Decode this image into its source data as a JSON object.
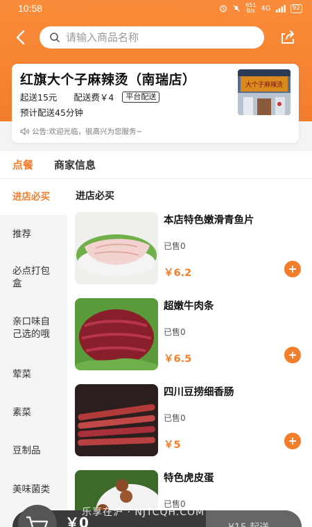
{
  "status_bar": {
    "time": "10:58",
    "net_speed_top": "651",
    "net_speed_bottom": "B/s",
    "signal": "4G",
    "battery": "92"
  },
  "nav": {
    "search_placeholder": "请输入商品名称"
  },
  "shop": {
    "name": "红旗大个子麻辣烫（南瑞店）",
    "min_order": "起送15元",
    "delivery_fee": "配送费￥4",
    "delivery_tag": "平台配送",
    "eta": "预计配送45分钟",
    "notice": "公告:欢迎光临，很高兴为您服务~",
    "sign_text": "大个子麻辣烫"
  },
  "tabs": [
    {
      "label": "点餐"
    },
    {
      "label": "商家信息"
    }
  ],
  "sidebar": {
    "items": [
      {
        "label": "进店必买"
      },
      {
        "label": "推荐"
      },
      {
        "label": "必点打包盒"
      },
      {
        "label": "亲口味自己选的哦"
      },
      {
        "label": "荤菜"
      },
      {
        "label": "素菜"
      },
      {
        "label": "豆制品"
      },
      {
        "label": "美味菌类"
      }
    ]
  },
  "section": {
    "title": "进店必买"
  },
  "products": [
    {
      "name": "本店特色嫩滑青鱼片",
      "sold": "已售0",
      "price": "￥6.2"
    },
    {
      "name": "超嫩牛肉条",
      "sold": "已售0",
      "price": "￥6.5"
    },
    {
      "name": "四川豆捞细香肠",
      "sold": "已售0",
      "price": "￥5"
    },
    {
      "name": "特色虎皮蛋",
      "sold": "已售0",
      "price": ""
    }
  ],
  "cart": {
    "total": "￥0",
    "checkout": "¥15 起送"
  },
  "watermark": "乐享在沪 · NJTCQH.COM",
  "colors": {
    "accent": "#f47d2c",
    "header_bg": "#f98c3a"
  }
}
